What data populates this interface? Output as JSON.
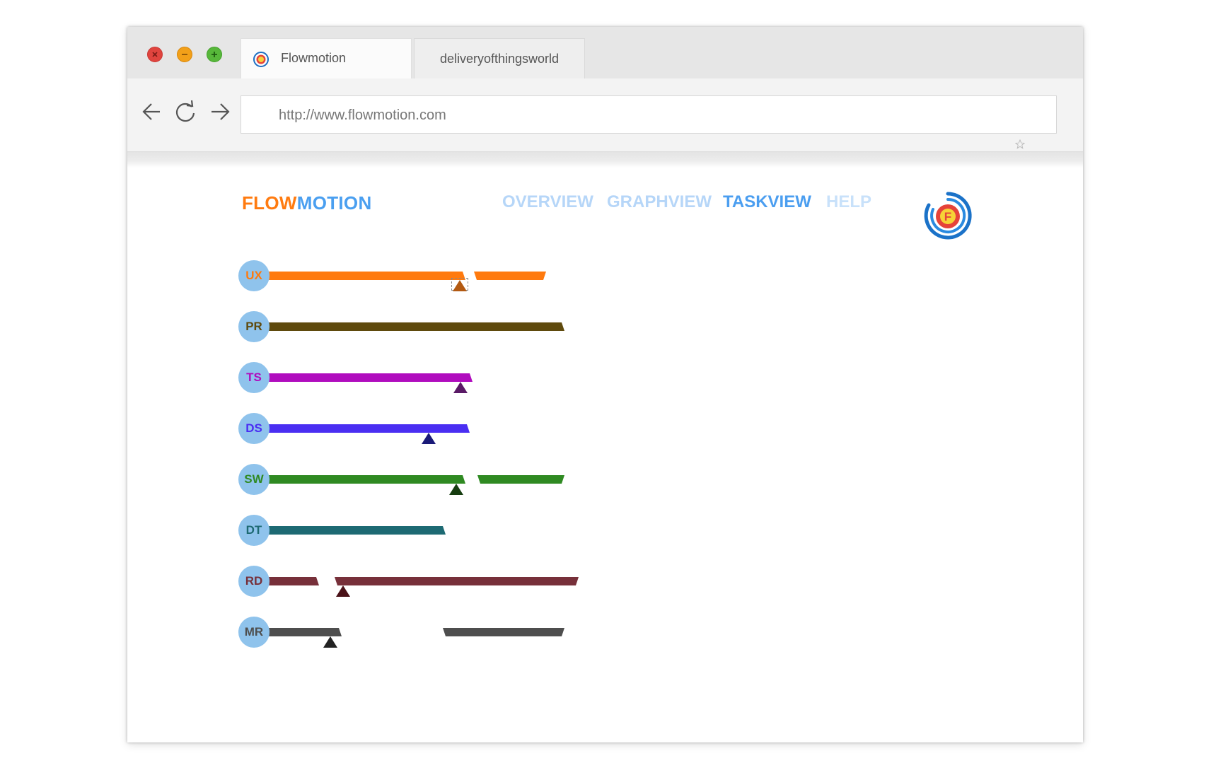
{
  "window": {
    "controls": {
      "close": "close-icon",
      "minimize": "minimize-icon",
      "maximize": "maximize-icon"
    },
    "tabs": [
      {
        "title": "Flowmotion",
        "active": true,
        "icon": "flowmotion-favicon-icon"
      },
      {
        "title": "deliveryofthingsworld",
        "active": false
      }
    ],
    "toolbar": {
      "back_icon": "back-arrow-icon",
      "reload_icon": "reload-icon",
      "forward_icon": "forward-arrow-icon",
      "url": "http://www.flowmotion.com",
      "bookmark_icon": "star-icon"
    }
  },
  "app": {
    "brand": {
      "part1": "FLOW",
      "part2": "MOTION",
      "part1_color": "#ff7b10",
      "part2_color": "#4a9ff0"
    },
    "nav": [
      {
        "label": "OVERVIEW",
        "active": false
      },
      {
        "label": "GRAPHVIEW",
        "active": false
      },
      {
        "label": "TASKVIEW",
        "active": true
      },
      {
        "label": "HELP",
        "active": false
      }
    ],
    "logo": {
      "icon": "flowmotion-logo-icon",
      "letter": "F"
    }
  },
  "taskview": {
    "lanes": [
      {
        "code": "UX",
        "color": "#ff7a0e",
        "marker_color": "#b35a12",
        "marker_selected": true
      },
      {
        "code": "PR",
        "color": "#5f4a0d",
        "marker_color": null,
        "marker_selected": false
      },
      {
        "code": "TS",
        "color": "#b00cbe",
        "marker_color": "#5a1a66",
        "marker_selected": false
      },
      {
        "code": "DS",
        "color": "#4a2ef2",
        "marker_color": "#1a1a78",
        "marker_selected": false
      },
      {
        "code": "SW",
        "color": "#2f8a22",
        "marker_color": "#163d10",
        "marker_selected": false
      },
      {
        "code": "DT",
        "color": "#1d6a73",
        "marker_color": null,
        "marker_selected": false
      },
      {
        "code": "RD",
        "color": "#77303a",
        "marker_color": "#4a1118",
        "marker_selected": false
      },
      {
        "code": "MR",
        "color": "#4e4e4e",
        "marker_color": "#222222",
        "marker_selected": false
      }
    ]
  }
}
